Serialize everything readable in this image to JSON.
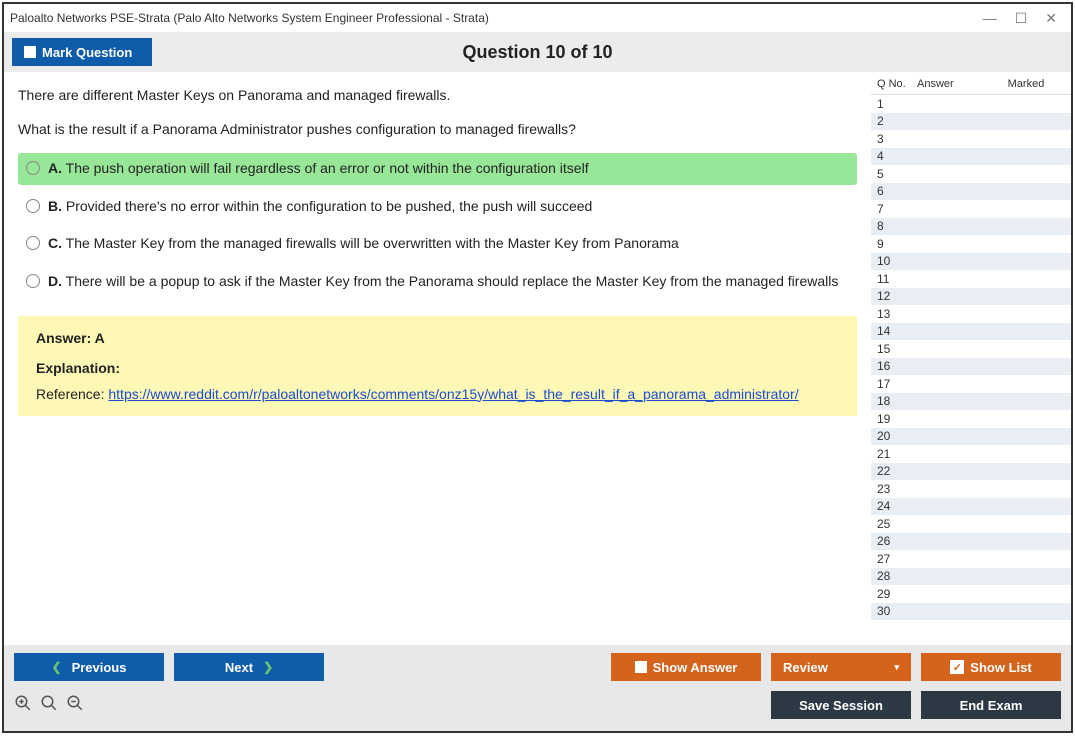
{
  "window": {
    "title": "Paloalto Networks PSE-Strata (Palo Alto Networks System Engineer Professional - Strata)"
  },
  "toolbar": {
    "mark_question": "Mark Question",
    "counter": "Question 10 of 10"
  },
  "question": {
    "line1": "There are different Master Keys on Panorama and managed firewalls.",
    "line2": "What is the result if a Panorama Administrator pushes configuration to managed firewalls?"
  },
  "options": {
    "a_letter": "A.",
    "a_text": " The push operation will fail regardless of an error or not within the configuration itself",
    "b_letter": "B.",
    "b_text": " Provided there's no error within the configuration to be pushed, the push will succeed",
    "c_letter": "C.",
    "c_text": " The Master Key from the managed firewalls will be overwritten with the Master Key from Panorama",
    "d_letter": "D.",
    "d_text": " There will be a popup to ask if the Master Key from the Panorama should replace the Master Key from the managed firewalls"
  },
  "answer": {
    "line": "Answer: A",
    "explanation_label": "Explanation:",
    "ref_prefix": "Reference: ",
    "ref_url": "https://www.reddit.com/r/paloaltonetworks/comments/onz15y/what_is_the_result_if_a_panorama_administrator/"
  },
  "sidebar": {
    "headers": {
      "qno": "Q No.",
      "answer": "Answer",
      "marked": "Marked"
    },
    "rows": [
      "1",
      "2",
      "3",
      "4",
      "5",
      "6",
      "7",
      "8",
      "9",
      "10",
      "11",
      "12",
      "13",
      "14",
      "15",
      "16",
      "17",
      "18",
      "19",
      "20",
      "21",
      "22",
      "23",
      "24",
      "25",
      "26",
      "27",
      "28",
      "29",
      "30"
    ]
  },
  "footer": {
    "previous": "Previous",
    "next": "Next",
    "show_answer": "Show Answer",
    "review": "Review",
    "show_list": "Show List",
    "save_session": "Save Session",
    "end_exam": "End Exam"
  }
}
